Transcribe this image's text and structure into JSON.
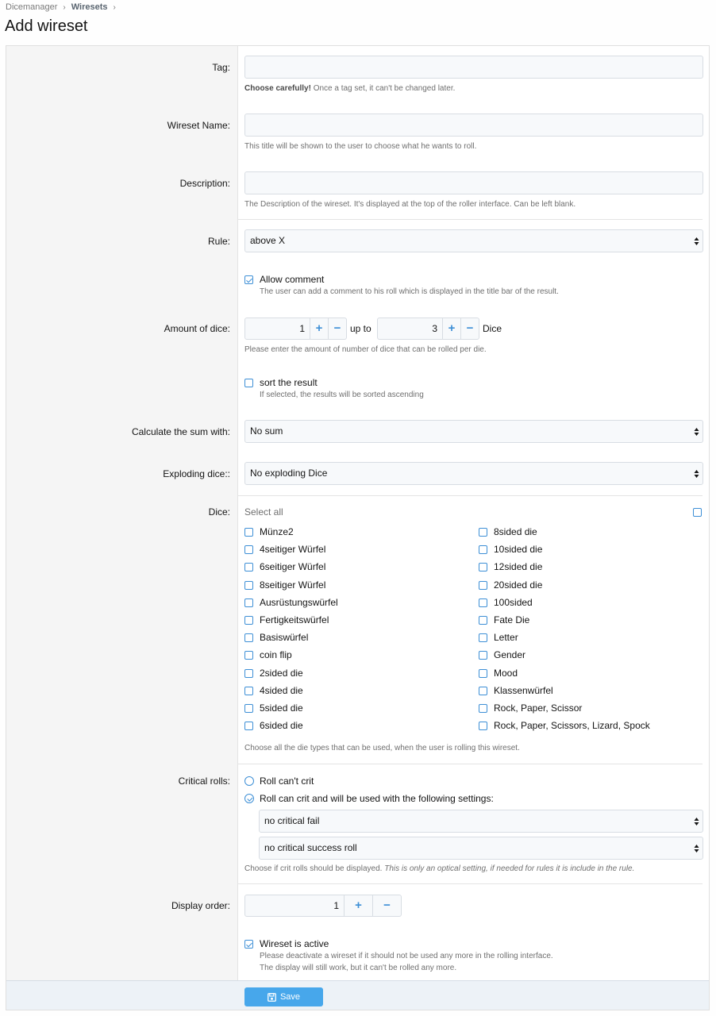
{
  "breadcrumb": {
    "root": "Dicemanager",
    "current": "Wiresets"
  },
  "page_title": "Add wireset",
  "tag": {
    "label": "Tag:",
    "value": "",
    "hint_bold": "Choose carefully!",
    "hint_rest": " Once a tag set, it can't be changed later."
  },
  "name": {
    "label": "Wireset Name:",
    "value": "",
    "hint": "This title will be shown to the user to choose what he wants to roll."
  },
  "description": {
    "label": "Description:",
    "value": "",
    "hint": "The Description of the wireset. It's displayed at the top of the roller interface. Can be left blank."
  },
  "rule": {
    "label": "Rule:",
    "value": "above X"
  },
  "allow_comment": {
    "label": "Allow comment",
    "hint": "The user can add a comment to his roll which is displayed in the title bar of the result.",
    "checked": true
  },
  "amount": {
    "label": "Amount of dice:",
    "min": "1",
    "up_to": "up to",
    "max": "3",
    "suffix": "Dice",
    "hint": "Please enter the amount of number of dice that can be rolled per die."
  },
  "sort": {
    "label": "sort the result",
    "hint": "If selected, the results will be sorted ascending",
    "checked": false
  },
  "sum": {
    "label": "Calculate the sum with:",
    "value": "No sum"
  },
  "exploding": {
    "label": "Exploding dice::",
    "value": "No exploding Dice"
  },
  "dice": {
    "label": "Dice:",
    "select_all": "Select all",
    "left": [
      "Münze2",
      "4seitiger Würfel",
      "6seitiger Würfel",
      "8seitiger Würfel",
      "Ausrüstungswürfel",
      "Fertigkeitswürfel",
      "Basiswürfel",
      "coin flip",
      "2sided die",
      "4sided die",
      "5sided die",
      "6sided die"
    ],
    "right": [
      "8sided die",
      "10sided die",
      "12sided die",
      "20sided die",
      "100sided",
      "Fate Die",
      "Letter",
      "Gender",
      "Mood",
      "Klassenwürfel",
      "Rock, Paper, Scissor",
      "Rock, Paper, Scissors, Lizard, Spock"
    ],
    "hint": "Choose all the die types that can be used, when the user is rolling this wireset."
  },
  "critical": {
    "label": "Critical rolls:",
    "opt1": "Roll can't crit",
    "opt2": "Roll can crit and will be used with the following settings:",
    "fail": "no critical fail",
    "success": "no critical success roll",
    "hint": "Choose if crit rolls should be displayed.",
    "hint_italic": " This is only an optical setting, if needed for rules it is include in the rule."
  },
  "display_order": {
    "label": "Display order:",
    "value": "1"
  },
  "active": {
    "label": "Wireset is active",
    "hint1": "Please deactivate a wireset if it should not be used any more in the rolling interface.",
    "hint2": "The display will still work, but it can't be rolled any more.",
    "checked": true
  },
  "save_label": "Save",
  "icons": {
    "plus": "+",
    "minus": "−"
  },
  "accent_color": "#47a7eb"
}
